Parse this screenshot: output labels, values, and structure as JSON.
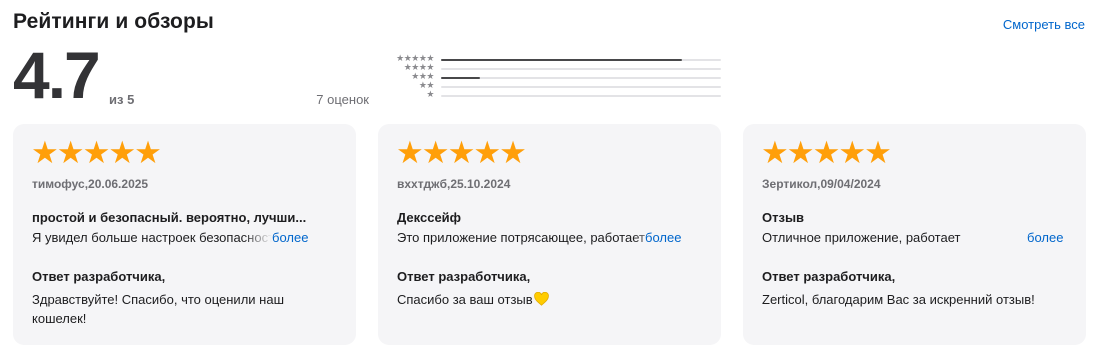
{
  "header": {
    "title": "Рейтинги и обзоры",
    "see_all": "Смотреть все"
  },
  "summary": {
    "score": "4.7",
    "out_of": "из 5",
    "count": "7 оценок"
  },
  "histogram": {
    "rows": [
      {
        "stars": "★★★★★",
        "fraction": 0.86
      },
      {
        "stars": "★★★★",
        "fraction": 0.0
      },
      {
        "stars": "★★★",
        "fraction": 0.14
      },
      {
        "stars": "★★",
        "fraction": 0.0
      },
      {
        "stars": "★",
        "fraction": 0.0
      }
    ]
  },
  "reviews": [
    {
      "stars": "★★★★★",
      "rating": 5,
      "author_date": "тимофус,20.06.2025",
      "title": "простой и безопасный. вероятно, лучши...",
      "body": "Я увидел больше настроек безопасности",
      "more": "более",
      "dev_label": "Ответ разработчика,",
      "dev_reply": "Здравствуйте! Спасибо, что оценили наш кошелек!"
    },
    {
      "stars": "★★★★★",
      "rating": 5,
      "author_date": "вххтджб,25.10.2024",
      "title": "Декссейф",
      "body": "Это приложение потрясающее, работает",
      "more": "более",
      "dev_label": "Ответ разработчика,",
      "dev_reply": "Спасибо за ваш отзыв",
      "dev_reply_icon": "yellow-heart-icon"
    },
    {
      "stars": "★★★★★",
      "rating": 5,
      "author_date": "Зертикол,09/04/2024",
      "title": "Отзыв",
      "body": "Отличное приложение, работает",
      "more": "более",
      "dev_label": "Ответ разработчика,",
      "dev_reply": "Zerticol, благодарим Вас за искренний отзыв!"
    }
  ],
  "colors": {
    "accent_link": "#0066cc",
    "star": "#ff9f0a",
    "card_bg": "#f5f5f7",
    "heart": "#ffcc00"
  }
}
